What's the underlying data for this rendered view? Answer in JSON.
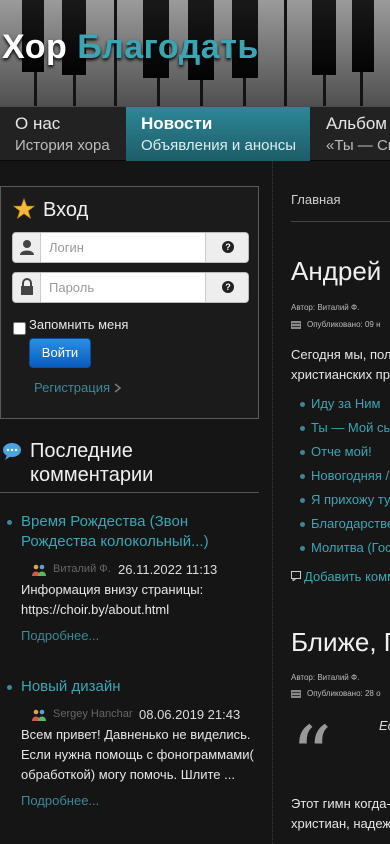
{
  "header": {
    "title_part1": "Хор",
    "title_part2": "Благодать"
  },
  "nav": [
    {
      "title": "О нас",
      "subtitle": "История хора"
    },
    {
      "title": "Новости",
      "subtitle": "Объявления и анонсы"
    },
    {
      "title": "Альбом",
      "subtitle": "«Ты — Си"
    }
  ],
  "login": {
    "title": "Вход",
    "username_placeholder": "Логин",
    "password_placeholder": "Пароль",
    "help_glyph": "?",
    "remember_label": "Запомнить меня",
    "submit_label": "Войти",
    "register_label": "Регистрация"
  },
  "comments": {
    "title": "Последние комментарии",
    "items": [
      {
        "link": "Время Рождества (Звон Рождества колокольный...)",
        "author": "Виталий Ф.",
        "date": "26.11.2022 11:13",
        "text": "Информация внизу страницы: https://choir.by/about.html",
        "more": "Подробнее..."
      },
      {
        "link": "Новый дизайн",
        "author": "Sergey Hanchar",
        "date": "08.06.2019 21:43",
        "text": "Всем привет! Давненько не виделись. Если нужна помощь с фонограммами( обработкой) могу помочь. Шлите ...",
        "more": "Подробнее..."
      }
    ]
  },
  "main": {
    "breadcrumb": "Главная",
    "article1": {
      "title": "Андрей К",
      "author": "Автор: Виталий Ф.",
      "published": "Опубликовано: 09 н",
      "text_line1": "Сегодня мы, пол",
      "text_line2": "христианских пре",
      "list": [
        "Иду за Ним",
        "Ты — Мой сы",
        "Отче мой!",
        "Новогодняя /",
        "Я прихожу ту",
        "Благодарстве",
        "Молитва (Гос"
      ],
      "add_comment": "Добавить комм"
    },
    "article2": {
      "title": "Ближе, Г",
      "author": "Автор: Виталий Ф.",
      "published": "Опубликовано: 28 о",
      "quote_mark": "“",
      "italic_text": "Ес",
      "text_line1": "Этот гимн когда-",
      "text_line2": "христиан, надеж"
    }
  },
  "colors": {
    "accent": "#3aa6b3",
    "link": "#3a8a97",
    "nav_active": "#2d8797",
    "button": "#1a73d4"
  }
}
